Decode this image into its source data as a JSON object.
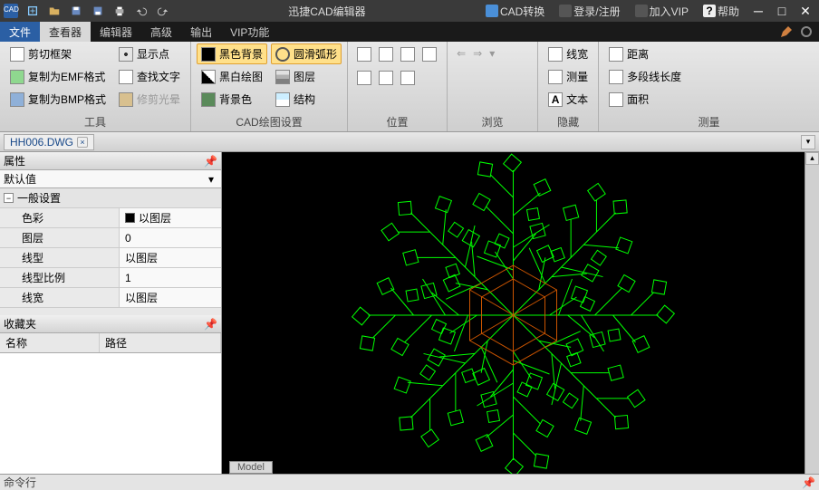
{
  "title": "迅捷CAD编辑器",
  "title_buttons": {
    "cad_convert": "CAD转换",
    "login": "登录/注册",
    "vip": "加入VIP",
    "help": "帮助"
  },
  "menu_tabs": {
    "file": "文件",
    "viewer": "查看器",
    "editor": "编辑器",
    "advanced": "高级",
    "output": "输出",
    "vip": "VIP功能"
  },
  "ribbon": {
    "tools": {
      "clip_frame": "剪切框架",
      "copy_emf": "复制为EMF格式",
      "copy_bmp": "复制为BMP格式",
      "show_point": "显示点",
      "find_text": "查找文字",
      "fix_halo": "修剪光晕",
      "label": "工具"
    },
    "cad_settings": {
      "black_bg": "黑色背景",
      "bw_draw": "黑白绘图",
      "bg_color": "背景色",
      "smooth_arc": "圆滑弧形",
      "layer": "图层",
      "structure": "结构",
      "label": "CAD绘图设置"
    },
    "position": {
      "label": "位置"
    },
    "browse": {
      "label": "浏览"
    },
    "hide": {
      "line_width": "线宽",
      "measure_txt": "测量",
      "text": "文本",
      "label": "隐藏"
    },
    "measure": {
      "distance": "距离",
      "polyline_len": "多段线长度",
      "area": "面积",
      "label": "测量"
    }
  },
  "doc_tab": {
    "name": "HH006.DWG"
  },
  "props": {
    "title": "属性",
    "default_val": "默认值",
    "section": "一般设置",
    "rows": {
      "color": {
        "k": "色彩",
        "v": "以图层"
      },
      "layer": {
        "k": "图层",
        "v": "0"
      },
      "linetype": {
        "k": "线型",
        "v": "以图层"
      },
      "ltscale": {
        "k": "线型比例",
        "v": "1"
      },
      "lineweight": {
        "k": "线宽",
        "v": "以图层"
      }
    }
  },
  "favorites": {
    "title": "收藏夹",
    "col_name": "名称",
    "col_path": "路径"
  },
  "model_tab": "Model",
  "cmd_line": "命令行"
}
